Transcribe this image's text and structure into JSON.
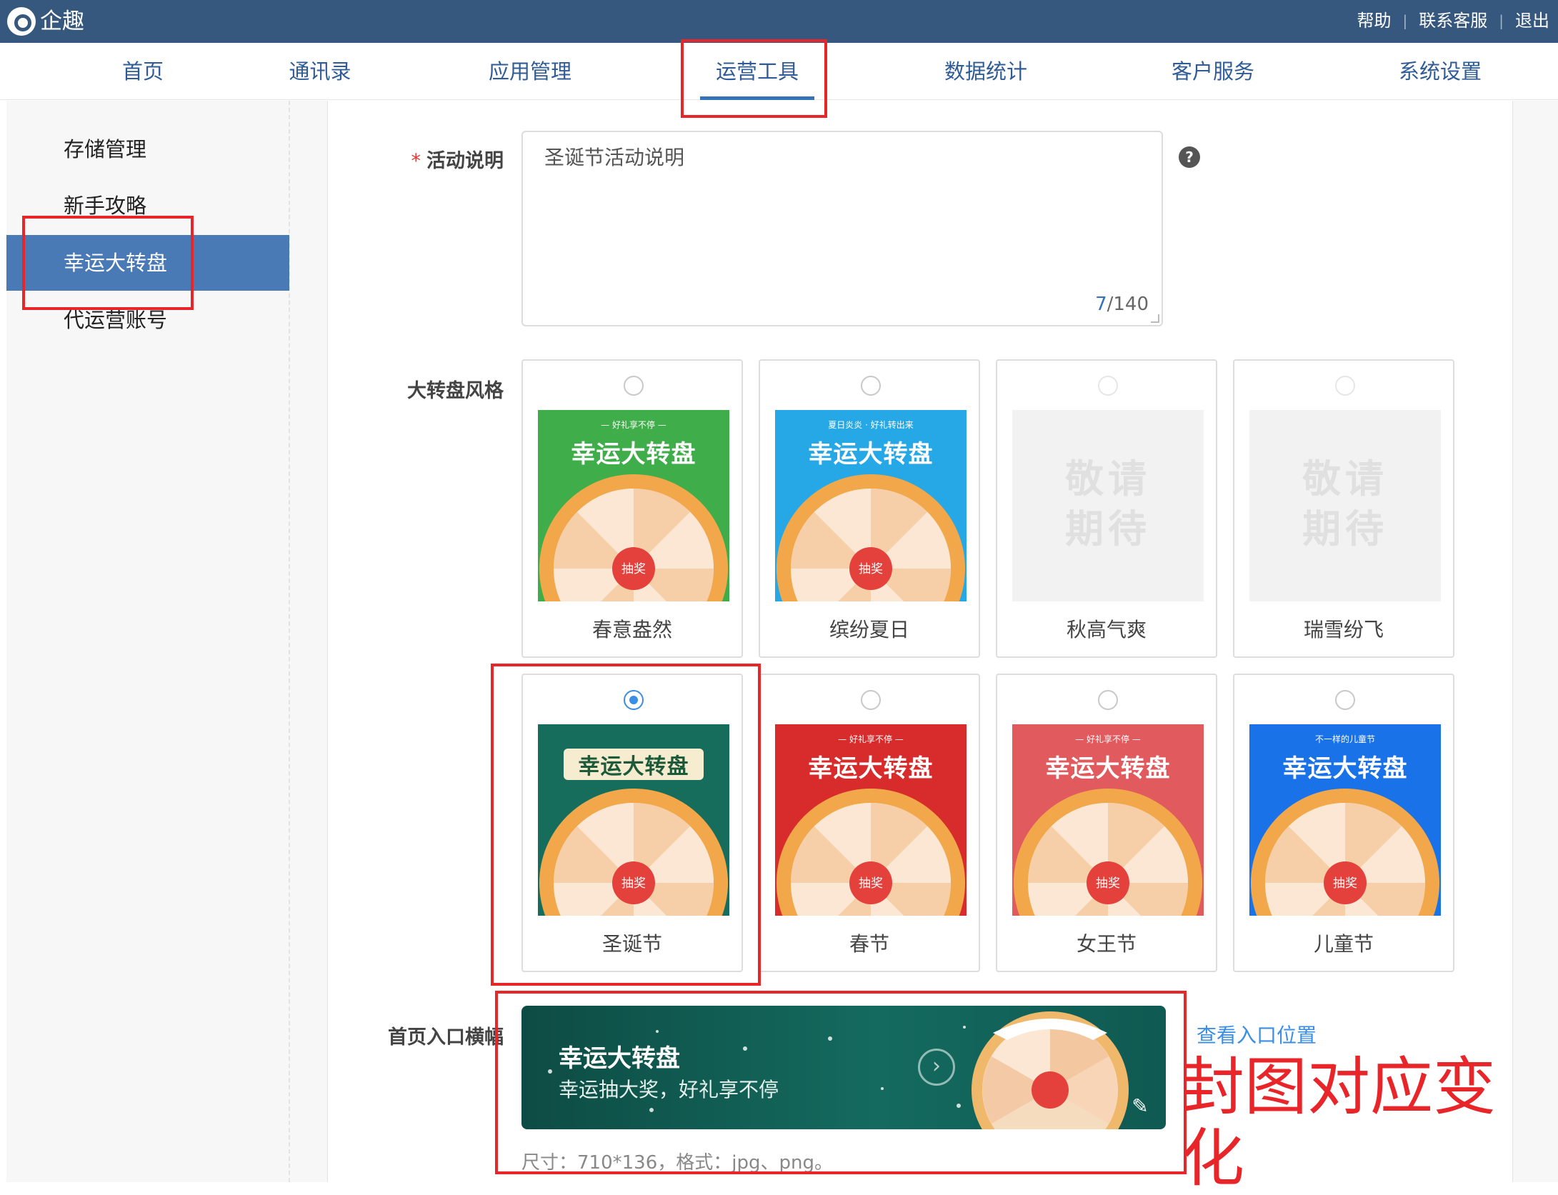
{
  "app": {
    "title": "企趣"
  },
  "top_links": [
    "帮助",
    "联系客服",
    "退出"
  ],
  "nav": {
    "items": [
      "首页",
      "通讯录",
      "应用管理",
      "运营工具",
      "数据统计",
      "客户服务",
      "系统设置"
    ],
    "active": "运营工具"
  },
  "sidebar": {
    "items": [
      "存储管理",
      "新手攻略",
      "幸运大转盘",
      "代运营账号"
    ],
    "active": "幸运大转盘"
  },
  "form": {
    "description": {
      "required_mark": "*",
      "label": "活动说明",
      "value": "圣诞节活动说明",
      "count_current": "7",
      "count_total": "/140"
    },
    "wheel_style": {
      "label": "大转盘风格",
      "options": [
        {
          "name": "春意盎然",
          "banner_sub": "— 好礼享不停 —",
          "banner_title": "幸运大转盘",
          "theme": "#3fae4a",
          "checked": false,
          "disabled": false
        },
        {
          "name": "缤纷夏日",
          "banner_sub": "夏日炎炎 · 好礼转出来",
          "banner_title": "幸运大转盘",
          "theme": "#27a8e6",
          "checked": false,
          "disabled": false
        },
        {
          "name": "秋高气爽",
          "placeholder": "敬请期待",
          "checked": false,
          "disabled": true
        },
        {
          "name": "瑞雪纷飞",
          "placeholder": "敬请期待",
          "checked": false,
          "disabled": true
        },
        {
          "name": "圣诞节",
          "banner_sub": "",
          "banner_title": "幸运大转盘",
          "theme": "#176d5c",
          "checked": true,
          "disabled": false
        },
        {
          "name": "春节",
          "banner_sub": "— 好礼享不停 —",
          "banner_title": "幸运大转盘",
          "theme": "#d82c2c",
          "checked": false,
          "disabled": false
        },
        {
          "name": "女王节",
          "banner_sub": "— 好礼享不停 —",
          "banner_title": "幸运大转盘",
          "theme": "#e05a5e",
          "checked": false,
          "disabled": false
        },
        {
          "name": "儿童节",
          "banner_sub": "不一样的儿童节",
          "banner_title": "幸运大转盘",
          "theme": "#1a72e8",
          "checked": false,
          "disabled": false
        }
      ],
      "wheel_center_label": "抽奖"
    },
    "entry_banner": {
      "label": "首页入口横幅",
      "title": "幸运大转盘",
      "subtitle": "幸运抽大奖，好礼享不停",
      "view_link": "查看入口位置",
      "size_hint": "尺寸：710*136，格式：jpg、png。"
    }
  },
  "annotation": {
    "text": "封图对应变化",
    "color": "#e8262a"
  }
}
